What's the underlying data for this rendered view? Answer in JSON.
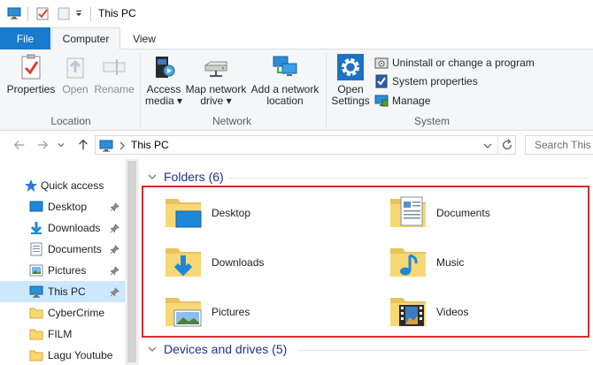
{
  "window": {
    "title": "This PC"
  },
  "ribbon_tabs": [
    {
      "label": "File"
    },
    {
      "label": "Computer"
    },
    {
      "label": "View"
    }
  ],
  "ribbon": {
    "location": {
      "label": "Location",
      "buttons": [
        {
          "label": "Properties",
          "enabled": true
        },
        {
          "label": "Open",
          "enabled": false
        },
        {
          "label": "Rename",
          "enabled": false
        }
      ]
    },
    "network": {
      "label": "Network",
      "buttons": [
        {
          "line1": "Access",
          "line2": "media ▾"
        },
        {
          "line1": "Map network",
          "line2": "drive ▾"
        },
        {
          "line1": "Add a network",
          "line2": "location"
        }
      ]
    },
    "system": {
      "label": "System",
      "open_settings": {
        "line1": "Open",
        "line2": "Settings"
      },
      "small_buttons": [
        {
          "label": "Uninstall or change a program"
        },
        {
          "label": "System properties"
        },
        {
          "label": "Manage"
        }
      ]
    }
  },
  "address": {
    "path": "This PC",
    "search_placeholder": "Search This PC"
  },
  "nav_pane": {
    "items": [
      {
        "label": "Quick access",
        "icon": "star-icon",
        "pinned": false,
        "selected": false
      },
      {
        "label": "Desktop",
        "icon": "desktop-icon",
        "pinned": true,
        "selected": false
      },
      {
        "label": "Downloads",
        "icon": "download-icon",
        "pinned": true,
        "selected": false
      },
      {
        "label": "Documents",
        "icon": "document-icon",
        "pinned": true,
        "selected": false
      },
      {
        "label": "Pictures",
        "icon": "picture-icon",
        "pinned": true,
        "selected": false
      },
      {
        "label": "This PC",
        "icon": "monitor-icon",
        "pinned": true,
        "selected": true
      },
      {
        "label": "CyberCrime",
        "icon": "folder-icon",
        "pinned": false,
        "selected": false
      },
      {
        "label": "FILM",
        "icon": "folder-icon",
        "pinned": false,
        "selected": false
      },
      {
        "label": "Lagu Youtube",
        "icon": "folder-icon",
        "pinned": false,
        "selected": false
      }
    ]
  },
  "content": {
    "folders_header": "Folders (6)",
    "devices_header": "Devices and drives (5)",
    "folders": [
      {
        "label": "Desktop",
        "icon": "desktop-folder-icon"
      },
      {
        "label": "Documents",
        "icon": "documents-folder-icon"
      },
      {
        "label": "Downloads",
        "icon": "downloads-folder-icon"
      },
      {
        "label": "Music",
        "icon": "music-folder-icon"
      },
      {
        "label": "Pictures",
        "icon": "pictures-folder-icon"
      },
      {
        "label": "Videos",
        "icon": "videos-folder-icon"
      }
    ]
  },
  "colors": {
    "accent": "#1979ca",
    "selection": "#cce8ff",
    "highlight_border": "#d92b2b",
    "section_header": "#1e3287"
  }
}
